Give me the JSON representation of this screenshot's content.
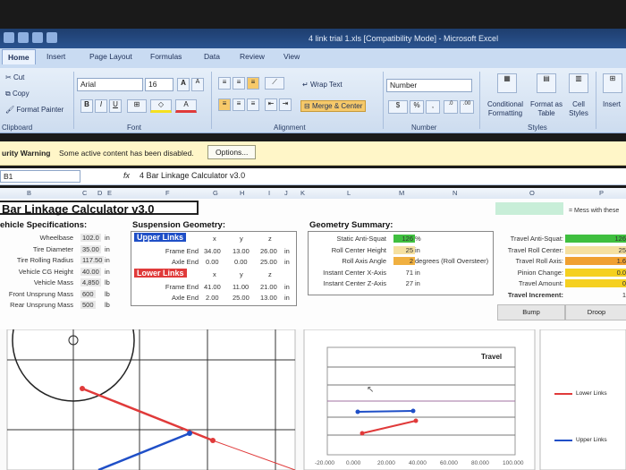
{
  "window": {
    "title": "4 link trial 1.xls [Compatibility Mode] - Microsoft Excel"
  },
  "tabs": [
    "Home",
    "Insert",
    "Page Layout",
    "Formulas",
    "Data",
    "Review",
    "View"
  ],
  "ribbon": {
    "clipboard": {
      "cut": "Cut",
      "copy": "Copy",
      "format_painter": "Format Painter",
      "label": "Clipboard"
    },
    "font": {
      "name": "Arial",
      "size": "16",
      "label": "Font",
      "bold": "B",
      "italic": "I",
      "underline": "U",
      "grow": "A",
      "shrink": "A"
    },
    "alignment": {
      "wrap": "Wrap Text",
      "merge": "Merge & Center",
      "label": "Alignment"
    },
    "number": {
      "format": "Number",
      "currency": "$",
      "percent": "%",
      "comma": ",",
      "label": "Number"
    },
    "styles": {
      "conditional": "Conditional Formatting",
      "format_table": "Format as Table",
      "cell_styles": "Cell Styles",
      "label": "Styles"
    },
    "cells": {
      "insert": "Insert"
    }
  },
  "security": {
    "warning": "urity Warning",
    "message": "Some active content has been disabled.",
    "options": "Options..."
  },
  "formula_bar": {
    "name_box": "B1",
    "fx": "fx",
    "content": "4 Bar Linkage Calculator v3.0"
  },
  "columns": [
    "B",
    "C",
    "D",
    "E",
    "F",
    "G",
    "H",
    "I",
    "J",
    "K",
    "L",
    "M",
    "N",
    "O",
    "P"
  ],
  "sheet": {
    "title": "Bar Linkage Calculator v3.0",
    "note": "= Mess with these",
    "vehicle": {
      "heading": "ehicle Specifications:",
      "rows": [
        {
          "label": "Wheelbase",
          "value": "102.0",
          "unit": "in"
        },
        {
          "label": "Tire Diameter",
          "value": "35.00",
          "unit": "in"
        },
        {
          "label": "Tire Rolling Radius",
          "value": "117.50",
          "unit": "in"
        },
        {
          "label": "Vehicle CG Height",
          "value": "40.00",
          "unit": "in"
        },
        {
          "label": "Vehicle Mass",
          "value": "4,850",
          "unit": "lb"
        },
        {
          "label": "Front Unsprung Mass",
          "value": "600",
          "unit": "lb"
        },
        {
          "label": "Rear Unsprung Mass",
          "value": "500",
          "unit": "lb"
        }
      ]
    },
    "suspension": {
      "heading": "Suspension Geometry:",
      "upper": {
        "label": "Upper Links",
        "cols": [
          "x",
          "y",
          "z"
        ],
        "frame": {
          "label": "Frame End",
          "x": "34.00",
          "y": "13.00",
          "z": "26.00",
          "unit": "in"
        },
        "axle": {
          "label": "Axle End",
          "x": "0.00",
          "y": "0.00",
          "z": "25.00",
          "unit": "in"
        }
      },
      "lower": {
        "label": "Lower Links",
        "cols": [
          "x",
          "y",
          "z"
        ],
        "frame": {
          "label": "Frame End",
          "x": "41.00",
          "y": "11.00",
          "z": "21.00",
          "unit": "in"
        },
        "axle": {
          "label": "Axle End",
          "x": "2.00",
          "y": "25.00",
          "z": "13.00",
          "unit": "in"
        }
      }
    },
    "geometry": {
      "heading": "Geometry Summary:",
      "rows": [
        {
          "label": "Static Anti-Squat",
          "value": "126",
          "unit": "%"
        },
        {
          "label": "Roll Center Height",
          "value": "25",
          "unit": "in"
        },
        {
          "label": "Roll Axis Angle",
          "value": "2",
          "unit": "degrees (Roll Oversteer)"
        },
        {
          "label": "Instant Center X-Axis",
          "value": "71",
          "unit": "in"
        },
        {
          "label": "Instant Center Z-Axis",
          "value": "27",
          "unit": "in"
        }
      ]
    },
    "travel": {
      "rows": [
        {
          "label": "Travel Anti-Squat:",
          "value": "126"
        },
        {
          "label": "Travel Roll Center:",
          "value": "25"
        },
        {
          "label": "Travel Roll Axis:",
          "value": "1.6"
        },
        {
          "label": "Pinion Change:",
          "value": "0.0"
        },
        {
          "label": "Travel Amount:",
          "value": "0"
        },
        {
          "label": "Travel Increment:",
          "value": "1"
        }
      ],
      "bump": "Bump",
      "droop": "Droop"
    }
  },
  "chart": {
    "title": "Travel",
    "legend": [
      "Lower Links",
      "Upper Links"
    ],
    "x_ticks": [
      "-20.000",
      "0.000",
      "20.000",
      "40.000",
      "60.000",
      "80.000",
      "100.000"
    ]
  },
  "colors": {
    "upper": "#1f4fc7",
    "lower": "#e03a3a",
    "green": "#3fbf3f",
    "orange": "#f0a030",
    "yellow": "#f5d020"
  }
}
